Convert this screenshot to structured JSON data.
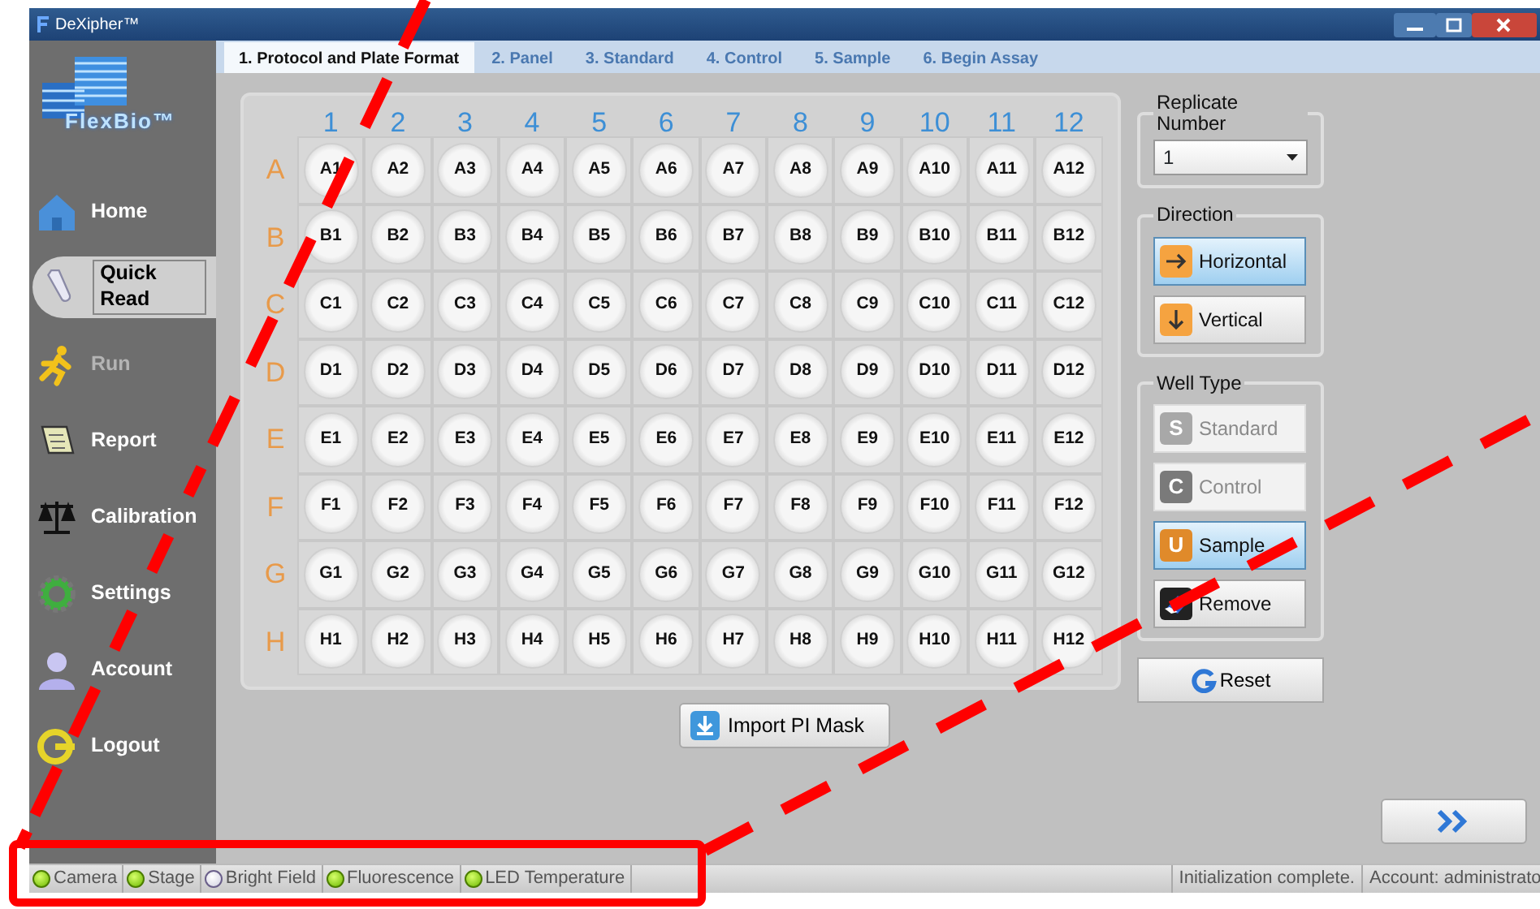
{
  "window": {
    "title": "DeXipher™"
  },
  "logo_text": "FlexBio™",
  "tabs": [
    {
      "label": "1. Protocol and Plate Format",
      "selected": true
    },
    {
      "label": "2. Panel",
      "selected": false
    },
    {
      "label": "3. Standard",
      "selected": false
    },
    {
      "label": "4. Control",
      "selected": false
    },
    {
      "label": "5. Sample",
      "selected": false
    },
    {
      "label": "6. Begin Assay",
      "selected": false
    }
  ],
  "sidebar": {
    "items": [
      {
        "label": "Home",
        "selected": false,
        "disabled": false
      },
      {
        "label": "Quick Read",
        "selected": true,
        "disabled": false
      },
      {
        "label": "Run",
        "selected": false,
        "disabled": true
      },
      {
        "label": "Report",
        "selected": false,
        "disabled": false
      },
      {
        "label": "Calibration",
        "selected": false,
        "disabled": false
      },
      {
        "label": "Settings",
        "selected": false,
        "disabled": false
      },
      {
        "label": "Account",
        "selected": false,
        "disabled": false
      },
      {
        "label": "Logout",
        "selected": false,
        "disabled": false
      }
    ]
  },
  "plate": {
    "columns": [
      "1",
      "2",
      "3",
      "4",
      "5",
      "6",
      "7",
      "8",
      "9",
      "10",
      "11",
      "12"
    ],
    "rows": [
      {
        "label": "A",
        "wells": [
          "A1",
          "A2",
          "A3",
          "A4",
          "A5",
          "A6",
          "A7",
          "A8",
          "A9",
          "A10",
          "A11",
          "A12"
        ]
      },
      {
        "label": "B",
        "wells": [
          "B1",
          "B2",
          "B3",
          "B4",
          "B5",
          "B6",
          "B7",
          "B8",
          "B9",
          "B10",
          "B11",
          "B12"
        ]
      },
      {
        "label": "C",
        "wells": [
          "C1",
          "C2",
          "C3",
          "C4",
          "C5",
          "C6",
          "C7",
          "C8",
          "C9",
          "C10",
          "C11",
          "C12"
        ]
      },
      {
        "label": "D",
        "wells": [
          "D1",
          "D2",
          "D3",
          "D4",
          "D5",
          "D6",
          "D7",
          "D8",
          "D9",
          "D10",
          "D11",
          "D12"
        ]
      },
      {
        "label": "E",
        "wells": [
          "E1",
          "E2",
          "E3",
          "E4",
          "E5",
          "E6",
          "E7",
          "E8",
          "E9",
          "E10",
          "E11",
          "E12"
        ]
      },
      {
        "label": "F",
        "wells": [
          "F1",
          "F2",
          "F3",
          "F4",
          "F5",
          "F6",
          "F7",
          "F8",
          "F9",
          "F10",
          "F11",
          "F12"
        ]
      },
      {
        "label": "G",
        "wells": [
          "G1",
          "G2",
          "G3",
          "G4",
          "G5",
          "G6",
          "G7",
          "G8",
          "G9",
          "G10",
          "G11",
          "G12"
        ]
      },
      {
        "label": "H",
        "wells": [
          "H1",
          "H2",
          "H3",
          "H4",
          "H5",
          "H6",
          "H7",
          "H8",
          "H9",
          "H10",
          "H11",
          "H12"
        ]
      }
    ]
  },
  "import_button": "Import PI Mask",
  "replicate": {
    "title": "Replicate Number",
    "value": "1"
  },
  "direction": {
    "title": "Direction",
    "options": [
      {
        "label": "Horizontal",
        "selected": true
      },
      {
        "label": "Vertical",
        "selected": false
      }
    ]
  },
  "well_type": {
    "title": "Well Type",
    "options": [
      {
        "label": "Standard",
        "badge": "S",
        "selected": false,
        "disabled": true
      },
      {
        "label": "Control",
        "badge": "C",
        "selected": false,
        "disabled": true
      },
      {
        "label": "Sample",
        "badge": "U",
        "selected": true,
        "disabled": false
      },
      {
        "label": "Remove",
        "selected": false,
        "disabled": false
      }
    ]
  },
  "reset_button": "Reset",
  "status_bar": {
    "lamps": [
      {
        "label": "Camera",
        "on": true
      },
      {
        "label": "Stage",
        "on": true
      },
      {
        "label": "Bright Field",
        "on": false
      },
      {
        "label": "Fluorescence",
        "on": true
      },
      {
        "label": "LED Temperature",
        "on": true
      }
    ],
    "messages": [
      "Initialization complete.",
      "Account: administrato"
    ]
  }
}
